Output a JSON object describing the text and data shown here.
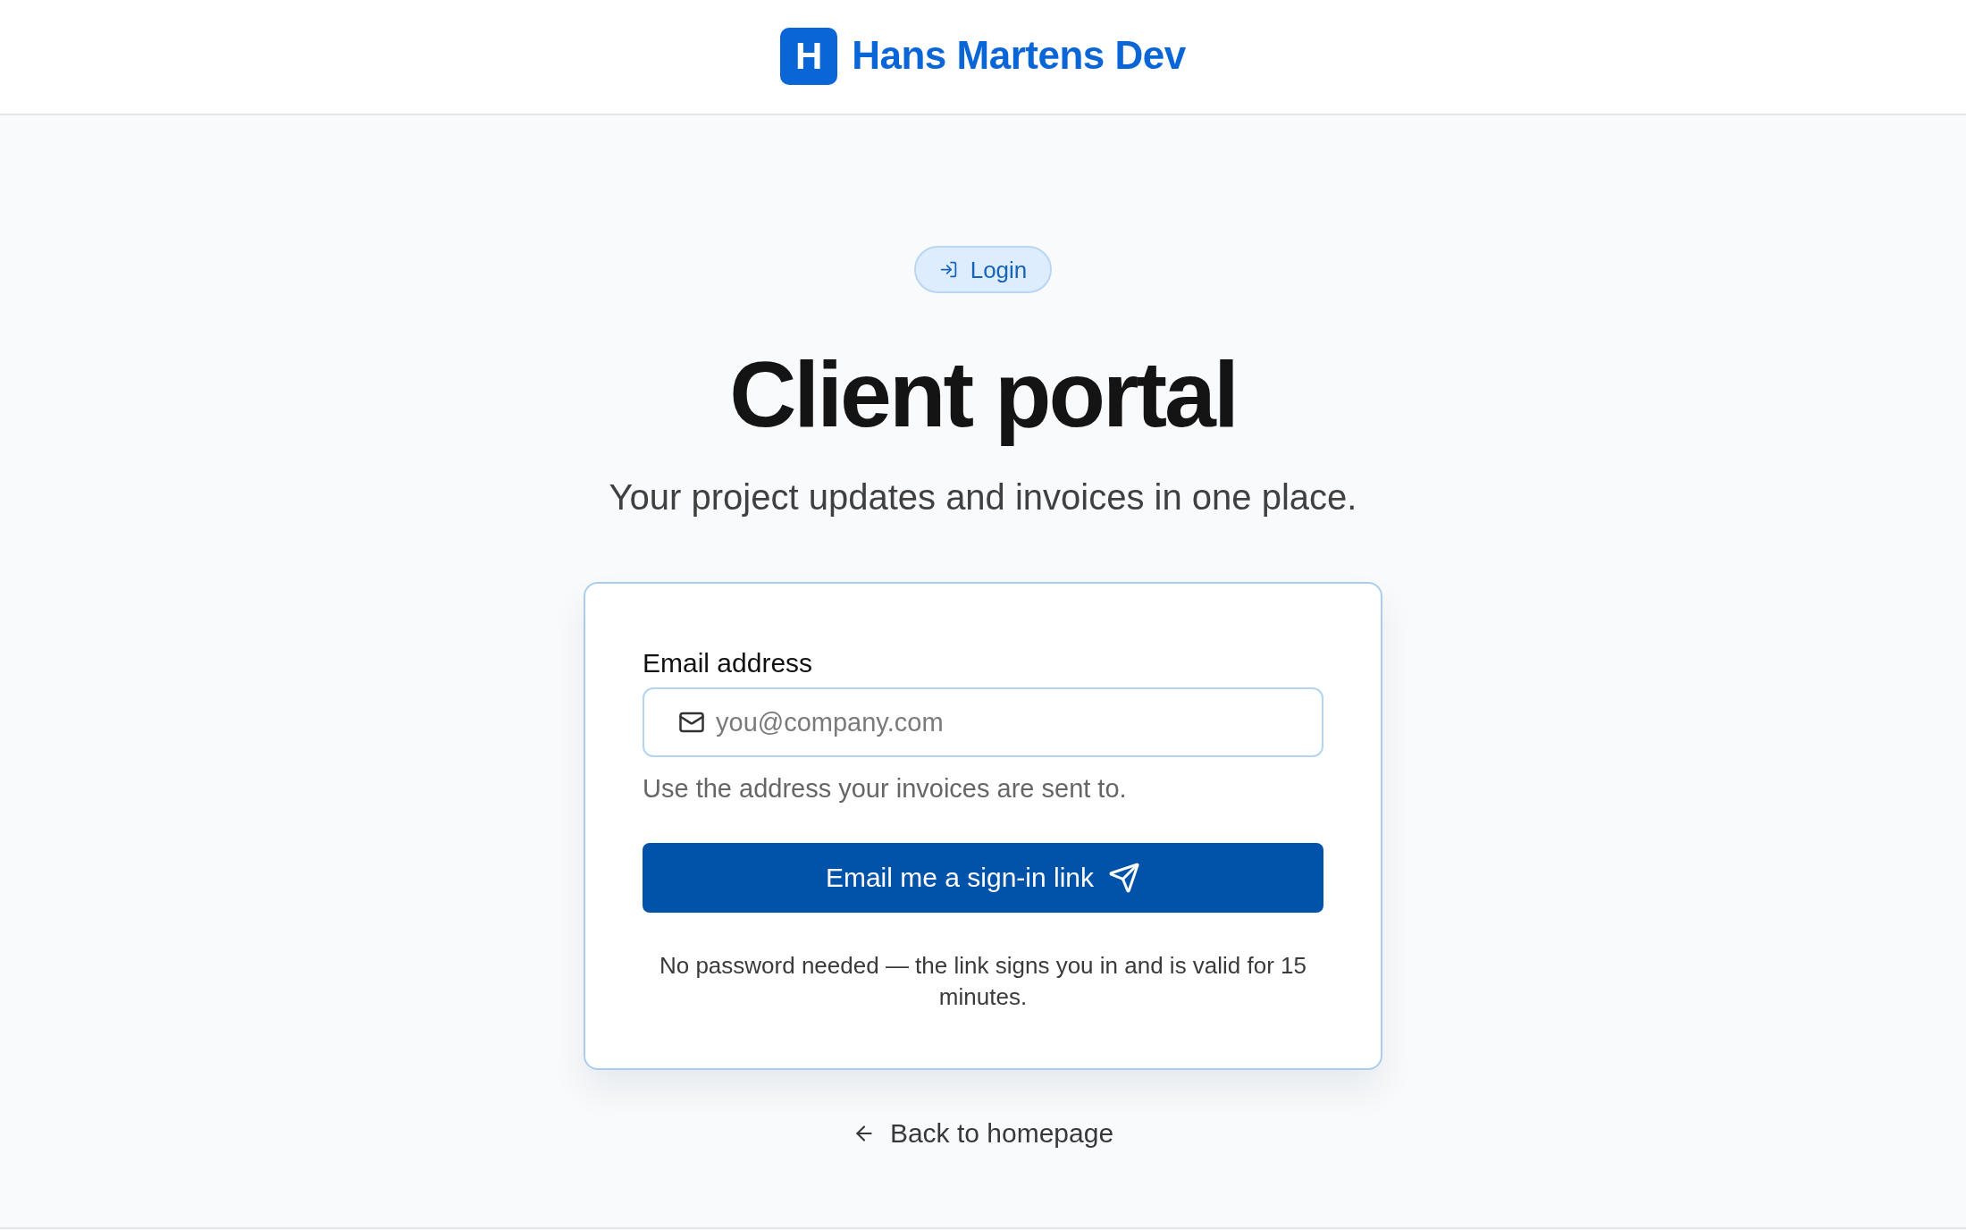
{
  "header": {
    "logo_letter": "H",
    "brand": "Hans Martens Dev"
  },
  "badge": {
    "label": "Login"
  },
  "title": "Client portal",
  "subtitle": "Your project updates and invoices in one place.",
  "form": {
    "email": {
      "label": "Email address",
      "placeholder": "you@company.com"
    },
    "hint": "Use the address your invoices are sent to.",
    "submit": {
      "label": "Email me a sign-in link"
    },
    "note": "No password needed — the link signs you in and is valid for 15 minutes."
  },
  "back_link": {
    "label": "Back to homepage"
  }
}
